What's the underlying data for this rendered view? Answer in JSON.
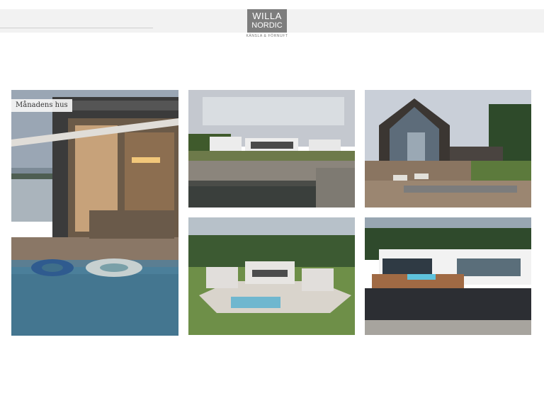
{
  "header": {
    "logo_line1": "WILLA",
    "logo_line2": "NORDIC",
    "tagline": "KÄNSLA & FÖRNUFT"
  },
  "gallery": {
    "featured_label": "Månadens hus"
  },
  "colors": {
    "logo_bg": "#7d7d7d",
    "header_bg": "#f2f2f2",
    "page_bg": "#ffffff"
  }
}
